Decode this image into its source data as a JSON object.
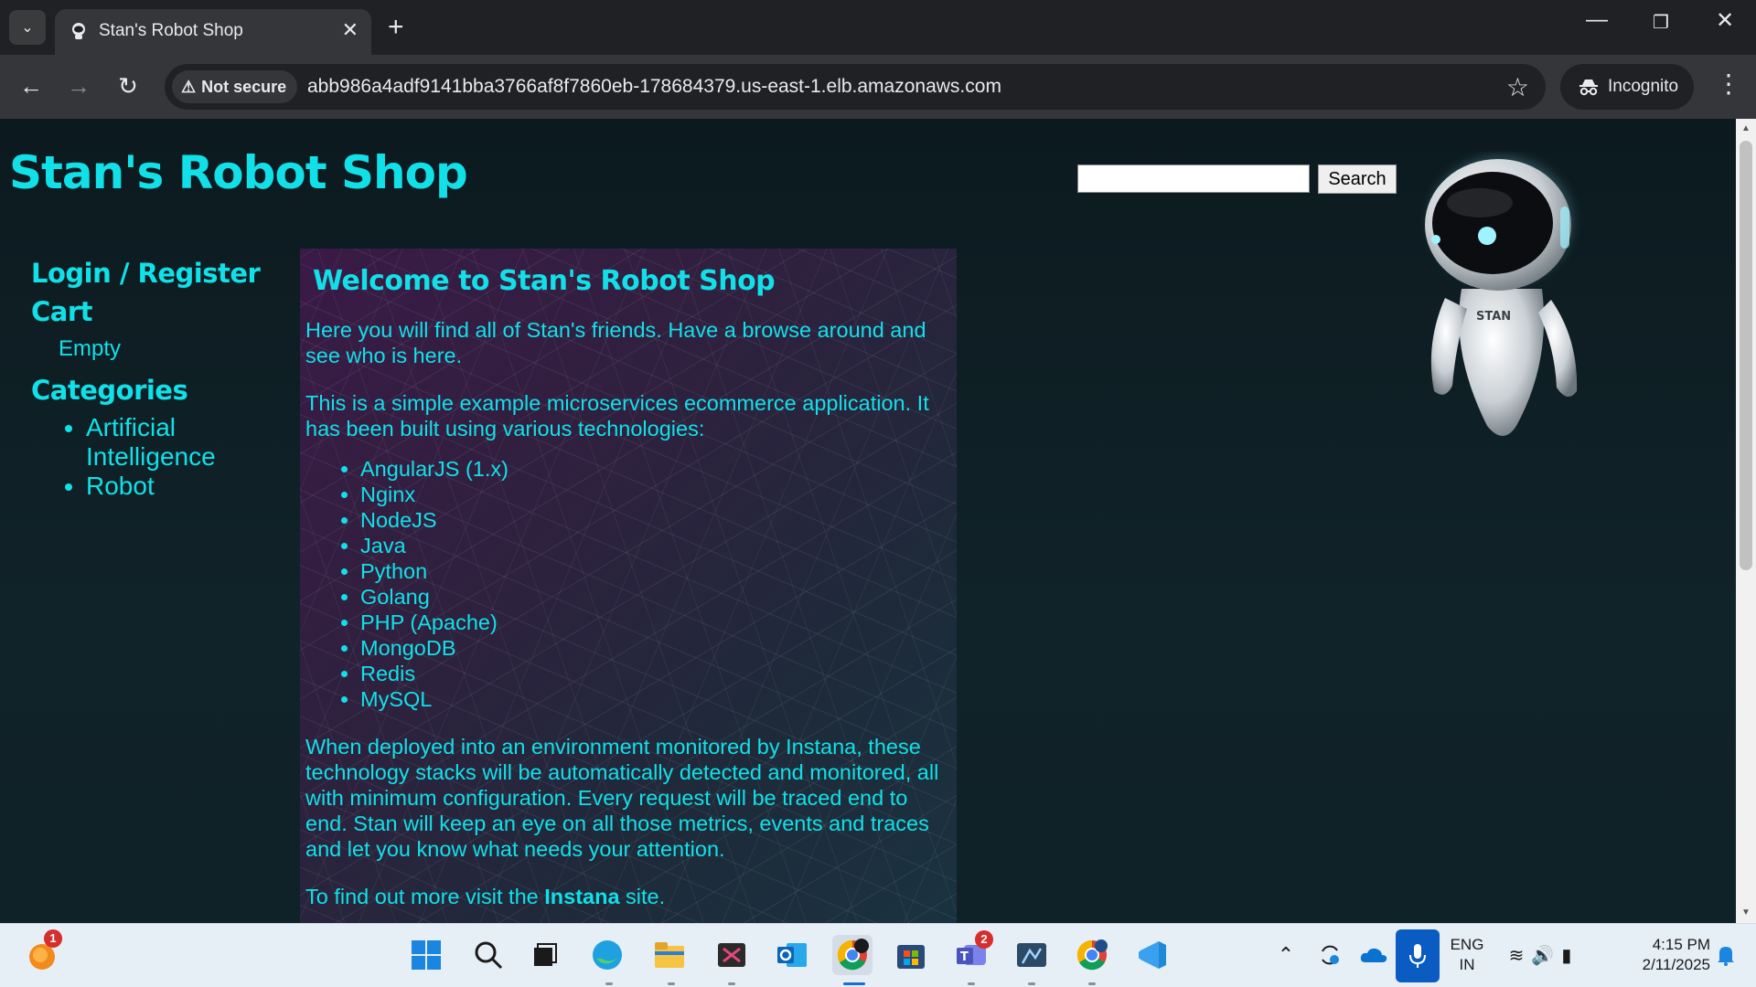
{
  "browser": {
    "tab_title": "Stan's Robot Shop",
    "security_label": "Not secure",
    "url": "abb986a4adf9141bba3766af8f7860eb-178684379.us-east-1.elb.amazonaws.com",
    "incognito_label": "Incognito"
  },
  "site": {
    "title": "Stan's Robot Shop",
    "search_button": "Search",
    "search_value": ""
  },
  "sidebar": {
    "login_label": "Login / Register",
    "cart_label": "Cart",
    "cart_status": "Empty",
    "categories_label": "Categories",
    "categories": [
      "Artificial Intelligence",
      "Robot"
    ]
  },
  "content": {
    "heading": "Welcome to Stan's Robot Shop",
    "intro": "Here you will find all of Stan's friends. Have a browse around and see who is here.",
    "description": "This is a simple example microservices ecommerce application. It has been built using various technologies:",
    "technologies": [
      "AngularJS (1.x)",
      "Nginx",
      "NodeJS",
      "Java",
      "Python",
      "Golang",
      "PHP (Apache)",
      "MongoDB",
      "Redis",
      "MySQL"
    ],
    "monitoring": "When deployed into an environment monitored by Instana, these technology stacks will be automatically detected and monitored, all with minimum configuration. Every request will be traced end to end. Stan will keep an eye on all those metrics, events and traces and let you know what needs your attention.",
    "more_prefix": "To find out more visit the ",
    "more_link": "Instana",
    "more_suffix": " site."
  },
  "robot_label": "STAN",
  "taskbar": {
    "notification_badge": "1",
    "teams_badge": "2",
    "language": "ENG",
    "region": "IN",
    "time": "4:15 PM",
    "date": "2/11/2025"
  },
  "colors": {
    "accent": "#12e0e8",
    "page_bg": "#0f1c22",
    "chrome_dark": "#202124",
    "chrome_toolbar": "#35363a"
  }
}
